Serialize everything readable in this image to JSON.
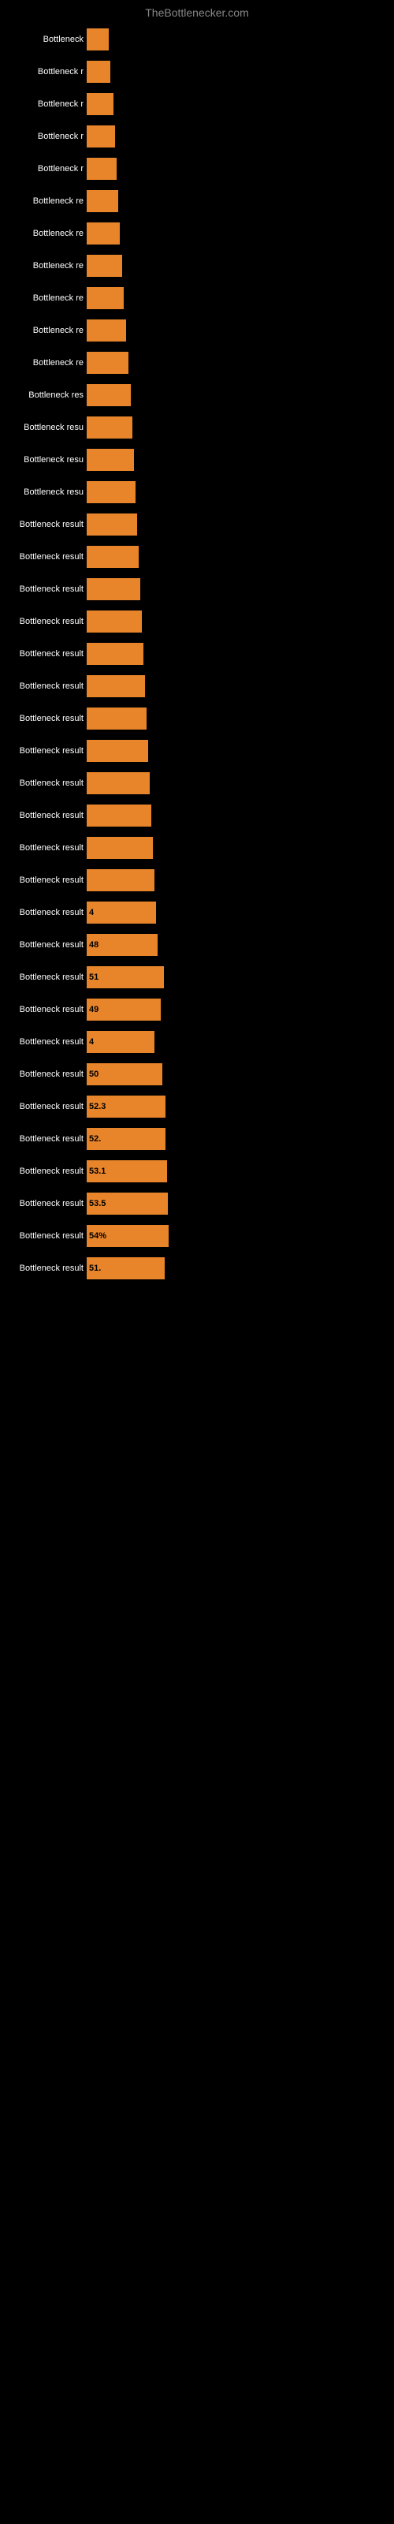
{
  "site": {
    "title": "TheBottlenecker.com"
  },
  "rows": [
    {
      "label": "Bottleneck",
      "value": "",
      "width": 28
    },
    {
      "label": "Bottleneck r",
      "value": "",
      "width": 30
    },
    {
      "label": "Bottleneck r",
      "value": "",
      "width": 34
    },
    {
      "label": "Bottleneck r",
      "value": "",
      "width": 36
    },
    {
      "label": "Bottleneck r",
      "value": "",
      "width": 38
    },
    {
      "label": "Bottleneck re",
      "value": "",
      "width": 40
    },
    {
      "label": "Bottleneck re",
      "value": "",
      "width": 42
    },
    {
      "label": "Bottleneck re",
      "value": "",
      "width": 45
    },
    {
      "label": "Bottleneck re",
      "value": "",
      "width": 47
    },
    {
      "label": "Bottleneck re",
      "value": "",
      "width": 50
    },
    {
      "label": "Bottleneck re",
      "value": "",
      "width": 53
    },
    {
      "label": "Bottleneck res",
      "value": "",
      "width": 56
    },
    {
      "label": "Bottleneck resu",
      "value": "",
      "width": 58
    },
    {
      "label": "Bottleneck resu",
      "value": "",
      "width": 60
    },
    {
      "label": "Bottleneck resu",
      "value": "",
      "width": 62
    },
    {
      "label": "Bottleneck result",
      "value": "",
      "width": 64
    },
    {
      "label": "Bottleneck result",
      "value": "",
      "width": 66
    },
    {
      "label": "Bottleneck result",
      "value": "",
      "width": 68
    },
    {
      "label": "Bottleneck result",
      "value": "",
      "width": 70
    },
    {
      "label": "Bottleneck result",
      "value": "",
      "width": 72
    },
    {
      "label": "Bottleneck result",
      "value": "",
      "width": 74
    },
    {
      "label": "Bottleneck result",
      "value": "",
      "width": 76
    },
    {
      "label": "Bottleneck result",
      "value": "",
      "width": 78
    },
    {
      "label": "Bottleneck result",
      "value": "",
      "width": 80
    },
    {
      "label": "Bottleneck result",
      "value": "",
      "width": 82
    },
    {
      "label": "Bottleneck result",
      "value": "",
      "width": 84
    },
    {
      "label": "Bottleneck result",
      "value": "",
      "width": 86
    },
    {
      "label": "Bottleneck result",
      "value": "4",
      "width": 88
    },
    {
      "label": "Bottleneck result",
      "value": "48",
      "width": 90
    },
    {
      "label": "Bottleneck result",
      "value": "51",
      "width": 98
    },
    {
      "label": "Bottleneck result",
      "value": "49",
      "width": 94
    },
    {
      "label": "Bottleneck result",
      "value": "4",
      "width": 86
    },
    {
      "label": "Bottleneck result",
      "value": "50",
      "width": 96
    },
    {
      "label": "Bottleneck result",
      "value": "52.3",
      "width": 100
    },
    {
      "label": "Bottleneck result",
      "value": "52.",
      "width": 100
    },
    {
      "label": "Bottleneck result",
      "value": "53.1",
      "width": 102
    },
    {
      "label": "Bottleneck result",
      "value": "53.5",
      "width": 103
    },
    {
      "label": "Bottleneck result",
      "value": "54%",
      "width": 104
    },
    {
      "label": "Bottleneck result",
      "value": "51.",
      "width": 99
    }
  ]
}
